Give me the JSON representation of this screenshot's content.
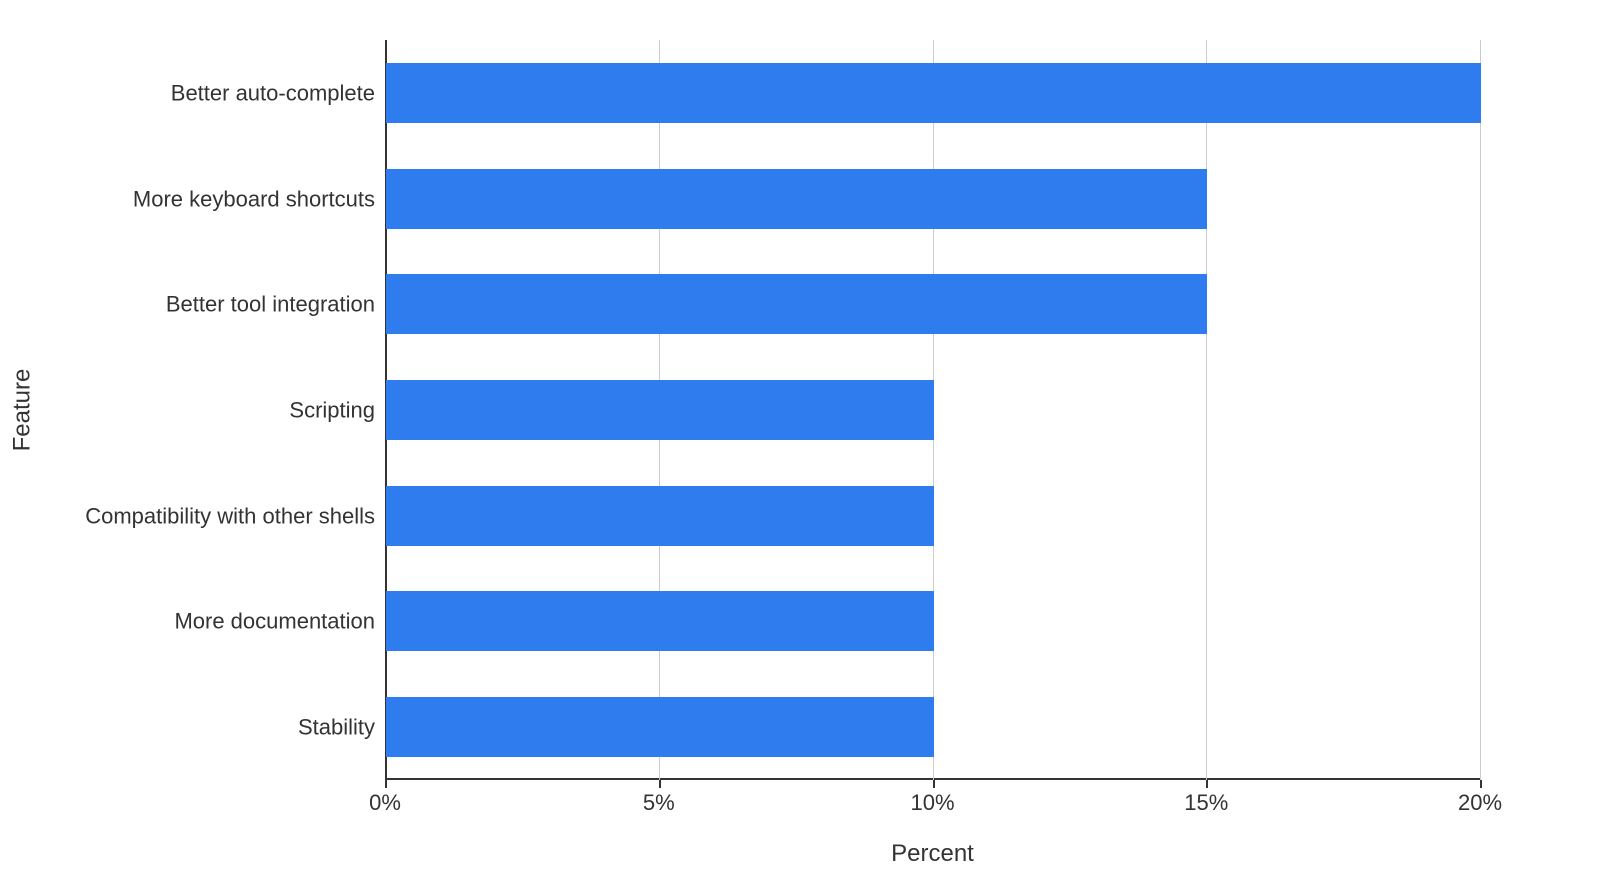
{
  "chart_data": {
    "type": "bar",
    "orientation": "horizontal",
    "categories": [
      "Better auto-complete",
      "More keyboard shortcuts",
      "Better tool integration",
      "Scripting",
      "Compatibility with other shells",
      "More documentation",
      "Stability"
    ],
    "values": [
      20,
      15,
      15,
      10,
      10,
      10,
      10
    ],
    "xlabel": "Percent",
    "ylabel": "Feature",
    "xticks": [
      0,
      5,
      10,
      15,
      20
    ],
    "xtick_labels": [
      "0%",
      "5%",
      "10%",
      "15%",
      "20%"
    ],
    "xlim": [
      0,
      20
    ],
    "bar_color": "#2f7cee"
  }
}
